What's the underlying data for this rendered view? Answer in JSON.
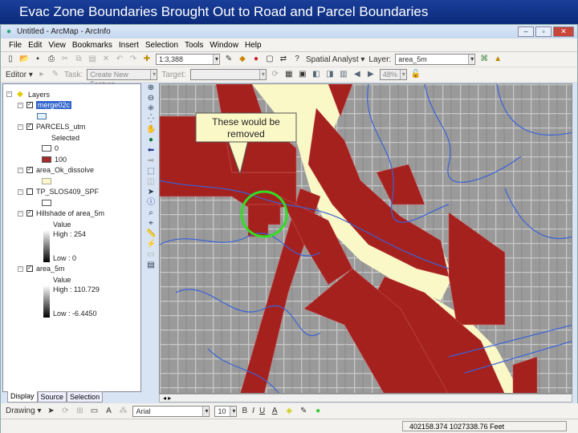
{
  "slide_title": "Evac Zone Boundaries Brought Out to Road and Parcel Boundaries",
  "window": {
    "title": "Untitled - ArcMap - ArcInfo",
    "minimize": "–",
    "maximize": "▫",
    "close": "✕"
  },
  "menu": [
    "File",
    "Edit",
    "View",
    "Bookmarks",
    "Insert",
    "Selection",
    "Tools",
    "Window",
    "Help"
  ],
  "toolbar": {
    "scale": "1:3,388",
    "spatial_analyst": "Spatial Analyst ▾",
    "layer_label": "Layer:",
    "layer_value": "area_5m"
  },
  "editor": {
    "editor_label": "Editor ▾",
    "task_label": "Task:",
    "task_value": "Create New Feature",
    "target_label": "Target:",
    "target_value": "",
    "zoom_pct": "48%"
  },
  "toc": {
    "root": "Layers",
    "layers": [
      {
        "name": "merge02c",
        "checked": true,
        "items": [
          {
            "swatch": "#e6f2fa",
            "label": ""
          }
        ]
      },
      {
        "name": "PARCELS_utm",
        "checked": true,
        "sub": "Selected",
        "items": [
          {
            "swatch": "#ffffff",
            "label": "0"
          },
          {
            "swatch": "#a52a2a",
            "label": "100"
          }
        ]
      },
      {
        "name": "area_Ok_dissolve",
        "checked": true,
        "items": [
          {
            "swatch": "#fbf8cc",
            "label": ""
          }
        ]
      },
      {
        "name": "TP_SLOS409_SPF",
        "checked": false,
        "items": [
          {
            "swatch": "#ffffff",
            "label": ""
          }
        ]
      },
      {
        "name": "Hillshade of area_5m",
        "checked": true,
        "sub": "Value",
        "high": "High : 254",
        "low": "Low : 0"
      },
      {
        "name": "area_5m",
        "checked": true,
        "sub": "Value",
        "high": "High : 110.729",
        "low": "Low : -6.4450"
      }
    ]
  },
  "toc_tabs": [
    "Display",
    "Source",
    "Selection"
  ],
  "map": {
    "callout": "These would be removed",
    "colors": {
      "parcel": "#a5211e",
      "zone": "#fbf8c8",
      "stream": "#3a62d8",
      "circle": "#33dd22"
    }
  },
  "drawing": {
    "label": "Drawing ▾",
    "font": "Arial",
    "size": "10",
    "bold": "B",
    "italic": "I",
    "underline": "U"
  },
  "status": {
    "coords": "402158.374  1027338.76 Feet"
  }
}
